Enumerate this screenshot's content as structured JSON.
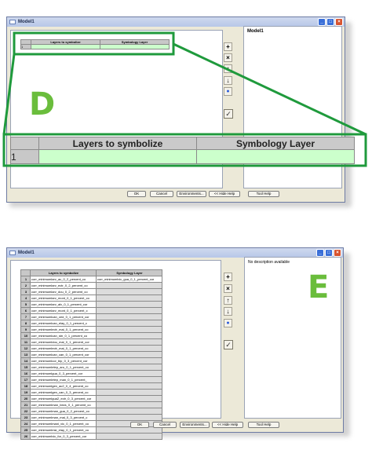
{
  "window1": {
    "title": "Model1",
    "right_title": "Model1",
    "callout_letter": "D",
    "table_small": {
      "columns": [
        "Layers to symbolize",
        "Symbology Layer"
      ],
      "row": "1"
    },
    "table_zoom": {
      "columns": [
        "Layers to symbolize",
        "Symbology Layer"
      ],
      "row": "1"
    }
  },
  "window2": {
    "title": "Model1",
    "right_desc": "No description available",
    "callout_letter": "E",
    "columns": [
      "Layers to symbolize",
      "Symbology Layer"
    ],
    "rows": [
      {
        "n": "1",
        "layer": "corr_minimumlarv_ac_0_2_percent_co",
        "sym": "corr_minimumlvic_gua_0_1_percent_cor"
      },
      {
        "n": "2",
        "layer": "corr_minimumlarv_ectr_0_2_percent_co",
        "sym": ""
      },
      {
        "n": "3",
        "layer": "corr_minimumlarv_dou_0_2_percent_co",
        "sym": ""
      },
      {
        "n": "4",
        "layer": "corr_minimumlarv_mont_0_1_percent_co",
        "sym": ""
      },
      {
        "n": "5",
        "layer": "corr_minimumlarv_alv_0_1_percent_cor",
        "sym": ""
      },
      {
        "n": "6",
        "layer": "corr_minimumlarv_mont_0_1_percent_c",
        "sym": ""
      },
      {
        "n": "7",
        "layer": "corr_minimumlcan_ced_0_1_percent_cor",
        "sym": ""
      },
      {
        "n": "8",
        "layer": "corr_minimumlcan_elay_0_1_percent_c",
        "sym": ""
      },
      {
        "n": "9",
        "layer": "corr_minimumlectr_mai_0_1_percent_co",
        "sym": ""
      },
      {
        "n": "10",
        "layer": "corr_minimumlcan_stn_0_1_percent_co",
        "sym": ""
      },
      {
        "n": "11",
        "layer": "corr_minimumldou_mai_0_1_percent_cor",
        "sym": ""
      },
      {
        "n": "12",
        "layer": "corr_minimumlectr_mai_0_1_percent_co",
        "sym": ""
      },
      {
        "n": "13",
        "layer": "corr_minimumlcan_can_0_1_percent_cor",
        "sym": ""
      },
      {
        "n": "14",
        "layer": "corr_minimumlcor_bip_0_3_percent_cor",
        "sym": ""
      },
      {
        "n": "15",
        "layer": "corr_minimumletep_aru_0_1_percent_co",
        "sym": ""
      },
      {
        "n": "16",
        "layer": "corr_minimumlgua_0_3_percent_cor",
        "sym": ""
      },
      {
        "n": "17",
        "layer": "corr_minimumletep_man_0_1_percent_",
        "sym": ""
      },
      {
        "n": "18",
        "layer": "corr_minimumlgen_ac2_0_4_percent_co",
        "sym": ""
      },
      {
        "n": "19",
        "layer": "corr_minimumlgen_can_0_3_percent_co",
        "sym": ""
      },
      {
        "n": "20",
        "layer": "corr_minimumlgua2_ectr_0_3_percent_cor",
        "sym": ""
      },
      {
        "n": "21",
        "layer": "corr_minimumlman_bezs_0_1_percent_co",
        "sym": ""
      },
      {
        "n": "22",
        "layer": "corr_minimumlman_gua_0_2_percent_co",
        "sym": ""
      },
      {
        "n": "23",
        "layer": "corr_minimumlman_mai_0_3_percent_c",
        "sym": ""
      },
      {
        "n": "24",
        "layer": "corr_minimumlmani_vic_0_1_percent_co",
        "sym": ""
      },
      {
        "n": "25",
        "layer": "corr_minimumlmsi_elay_0_1_percent_co",
        "sym": ""
      },
      {
        "n": "26",
        "layer": "corr_minimumlvic_for_0_3_percent_cor",
        "sym": ""
      }
    ]
  },
  "toolbar_icons": [
    "add-icon",
    "remove-icon",
    "move-up-icon",
    "move-down-icon",
    "info-icon"
  ],
  "buttons": {
    "ok": "OK",
    "cancel": "Cancel",
    "environments": "Environments...",
    "hide_help": "<< Hide Help",
    "tool_help": "Tool Help"
  },
  "colors": {
    "highlight_green": "#1f9a3c",
    "cell_green": "#ccffcc",
    "letter_green": "#6abd3c"
  }
}
